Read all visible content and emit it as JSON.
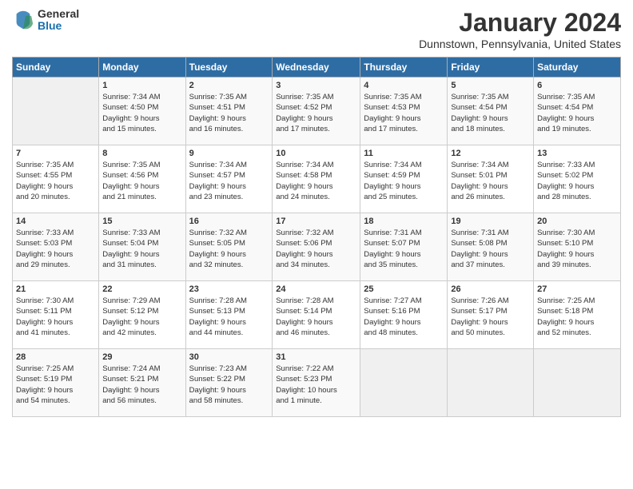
{
  "header": {
    "logo": {
      "general": "General",
      "blue": "Blue"
    },
    "title": "January 2024",
    "location": "Dunnstown, Pennsylvania, United States"
  },
  "days_of_week": [
    "Sunday",
    "Monday",
    "Tuesday",
    "Wednesday",
    "Thursday",
    "Friday",
    "Saturday"
  ],
  "weeks": [
    [
      {
        "day": "",
        "info": ""
      },
      {
        "day": "1",
        "info": "Sunrise: 7:34 AM\nSunset: 4:50 PM\nDaylight: 9 hours\nand 15 minutes."
      },
      {
        "day": "2",
        "info": "Sunrise: 7:35 AM\nSunset: 4:51 PM\nDaylight: 9 hours\nand 16 minutes."
      },
      {
        "day": "3",
        "info": "Sunrise: 7:35 AM\nSunset: 4:52 PM\nDaylight: 9 hours\nand 17 minutes."
      },
      {
        "day": "4",
        "info": "Sunrise: 7:35 AM\nSunset: 4:53 PM\nDaylight: 9 hours\nand 17 minutes."
      },
      {
        "day": "5",
        "info": "Sunrise: 7:35 AM\nSunset: 4:54 PM\nDaylight: 9 hours\nand 18 minutes."
      },
      {
        "day": "6",
        "info": "Sunrise: 7:35 AM\nSunset: 4:54 PM\nDaylight: 9 hours\nand 19 minutes."
      }
    ],
    [
      {
        "day": "7",
        "info": "Sunrise: 7:35 AM\nSunset: 4:55 PM\nDaylight: 9 hours\nand 20 minutes."
      },
      {
        "day": "8",
        "info": "Sunrise: 7:35 AM\nSunset: 4:56 PM\nDaylight: 9 hours\nand 21 minutes."
      },
      {
        "day": "9",
        "info": "Sunrise: 7:34 AM\nSunset: 4:57 PM\nDaylight: 9 hours\nand 23 minutes."
      },
      {
        "day": "10",
        "info": "Sunrise: 7:34 AM\nSunset: 4:58 PM\nDaylight: 9 hours\nand 24 minutes."
      },
      {
        "day": "11",
        "info": "Sunrise: 7:34 AM\nSunset: 4:59 PM\nDaylight: 9 hours\nand 25 minutes."
      },
      {
        "day": "12",
        "info": "Sunrise: 7:34 AM\nSunset: 5:01 PM\nDaylight: 9 hours\nand 26 minutes."
      },
      {
        "day": "13",
        "info": "Sunrise: 7:33 AM\nSunset: 5:02 PM\nDaylight: 9 hours\nand 28 minutes."
      }
    ],
    [
      {
        "day": "14",
        "info": "Sunrise: 7:33 AM\nSunset: 5:03 PM\nDaylight: 9 hours\nand 29 minutes."
      },
      {
        "day": "15",
        "info": "Sunrise: 7:33 AM\nSunset: 5:04 PM\nDaylight: 9 hours\nand 31 minutes."
      },
      {
        "day": "16",
        "info": "Sunrise: 7:32 AM\nSunset: 5:05 PM\nDaylight: 9 hours\nand 32 minutes."
      },
      {
        "day": "17",
        "info": "Sunrise: 7:32 AM\nSunset: 5:06 PM\nDaylight: 9 hours\nand 34 minutes."
      },
      {
        "day": "18",
        "info": "Sunrise: 7:31 AM\nSunset: 5:07 PM\nDaylight: 9 hours\nand 35 minutes."
      },
      {
        "day": "19",
        "info": "Sunrise: 7:31 AM\nSunset: 5:08 PM\nDaylight: 9 hours\nand 37 minutes."
      },
      {
        "day": "20",
        "info": "Sunrise: 7:30 AM\nSunset: 5:10 PM\nDaylight: 9 hours\nand 39 minutes."
      }
    ],
    [
      {
        "day": "21",
        "info": "Sunrise: 7:30 AM\nSunset: 5:11 PM\nDaylight: 9 hours\nand 41 minutes."
      },
      {
        "day": "22",
        "info": "Sunrise: 7:29 AM\nSunset: 5:12 PM\nDaylight: 9 hours\nand 42 minutes."
      },
      {
        "day": "23",
        "info": "Sunrise: 7:28 AM\nSunset: 5:13 PM\nDaylight: 9 hours\nand 44 minutes."
      },
      {
        "day": "24",
        "info": "Sunrise: 7:28 AM\nSunset: 5:14 PM\nDaylight: 9 hours\nand 46 minutes."
      },
      {
        "day": "25",
        "info": "Sunrise: 7:27 AM\nSunset: 5:16 PM\nDaylight: 9 hours\nand 48 minutes."
      },
      {
        "day": "26",
        "info": "Sunrise: 7:26 AM\nSunset: 5:17 PM\nDaylight: 9 hours\nand 50 minutes."
      },
      {
        "day": "27",
        "info": "Sunrise: 7:25 AM\nSunset: 5:18 PM\nDaylight: 9 hours\nand 52 minutes."
      }
    ],
    [
      {
        "day": "28",
        "info": "Sunrise: 7:25 AM\nSunset: 5:19 PM\nDaylight: 9 hours\nand 54 minutes."
      },
      {
        "day": "29",
        "info": "Sunrise: 7:24 AM\nSunset: 5:21 PM\nDaylight: 9 hours\nand 56 minutes."
      },
      {
        "day": "30",
        "info": "Sunrise: 7:23 AM\nSunset: 5:22 PM\nDaylight: 9 hours\nand 58 minutes."
      },
      {
        "day": "31",
        "info": "Sunrise: 7:22 AM\nSunset: 5:23 PM\nDaylight: 10 hours\nand 1 minute."
      },
      {
        "day": "",
        "info": ""
      },
      {
        "day": "",
        "info": ""
      },
      {
        "day": "",
        "info": ""
      }
    ]
  ]
}
